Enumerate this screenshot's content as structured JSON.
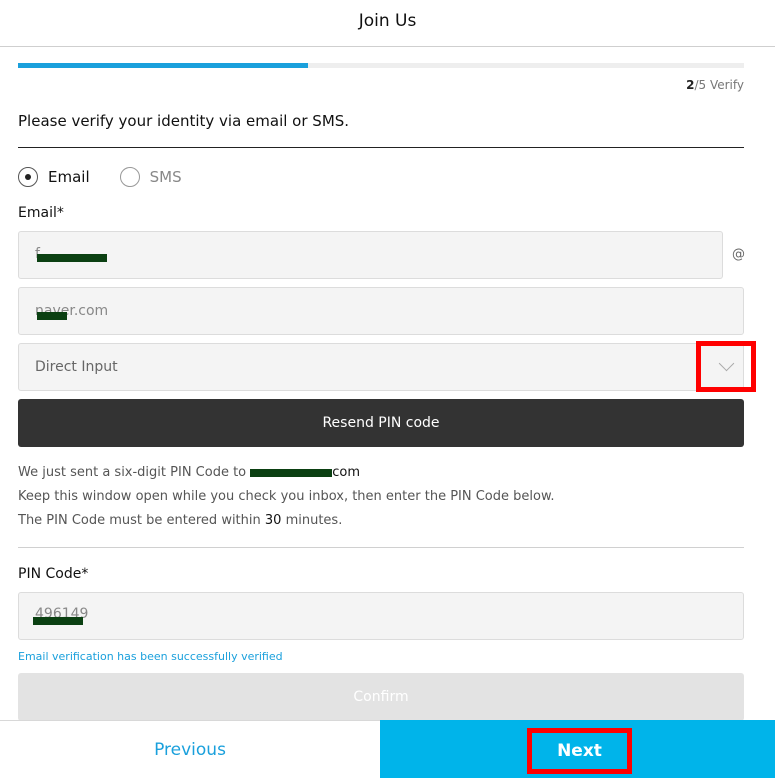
{
  "header": {
    "title": "Join Us"
  },
  "progress": {
    "current": "2",
    "total_text": "/5 Verify",
    "fraction": 0.4
  },
  "instruction": "Please verify your identity via email or SMS.",
  "method": {
    "options": [
      {
        "label": "Email",
        "selected": true
      },
      {
        "label": "SMS",
        "selected": false
      }
    ]
  },
  "email": {
    "label": "Email*",
    "local_value": "f",
    "at_symbol": "@",
    "domain_value": "naver.com",
    "domain_select": "Direct Input",
    "resend_label": "Resend PIN code"
  },
  "notice": {
    "line1_prefix": "We just sent a six-digit PIN Code to ",
    "line1_suffix": "com",
    "line2": "Keep this window open while you check you inbox, then enter the PIN Code below.",
    "line3_prefix": "The PIN Code must be entered within ",
    "line3_minutes": "30",
    "line3_suffix": " minutes."
  },
  "pin": {
    "label": "PIN Code*",
    "value": "496149",
    "success": "Email verification has been successfully verified",
    "confirm_label": "Confirm"
  },
  "footer": {
    "previous_label": "Previous",
    "next_label": "Next"
  },
  "colors": {
    "accent": "#00b4ea",
    "highlight": "#ff0000",
    "dark_button": "#333333"
  }
}
